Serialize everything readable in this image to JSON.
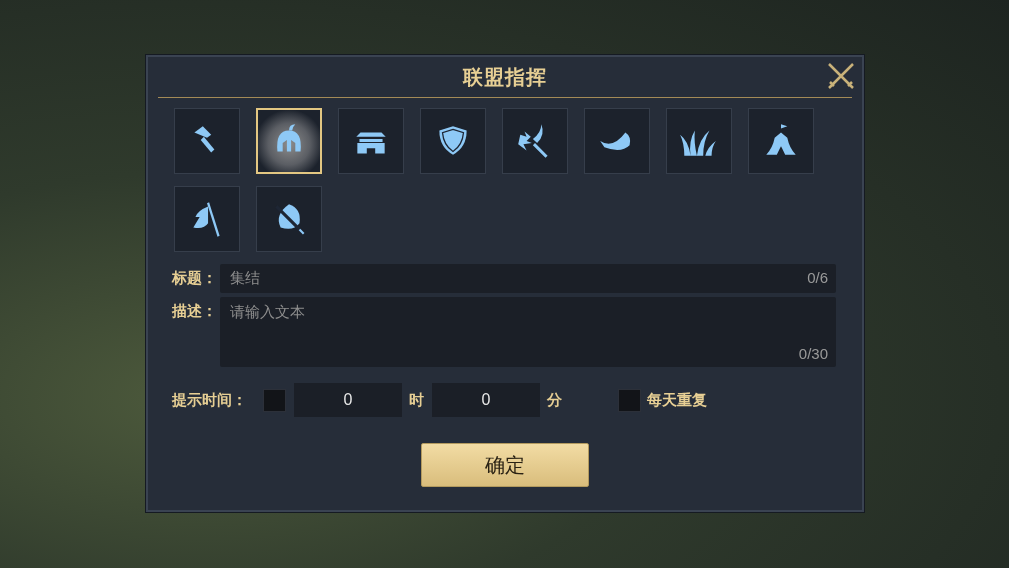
{
  "dialog": {
    "title": "联盟指挥",
    "icons": [
      {
        "selected": false
      },
      {
        "selected": true
      },
      {
        "selected": false
      },
      {
        "selected": false
      },
      {
        "selected": false
      },
      {
        "selected": false
      },
      {
        "selected": false
      },
      {
        "selected": false
      },
      {
        "selected": false
      },
      {
        "selected": false
      }
    ],
    "fields": [
      {
        "kind": "single",
        "label": "标题：",
        "placeholder": "集结",
        "counter": "0/6"
      },
      {
        "kind": "multi",
        "label": "描述：",
        "placeholder": "请输入文本",
        "counter": "0/30"
      }
    ],
    "reminder": {
      "label": "提示时间：",
      "checked": false,
      "hours": "0",
      "hours_unit": "时",
      "minutes": "0",
      "minutes_unit": "分",
      "repeat": {
        "label": "每天重复",
        "checked": false
      }
    },
    "confirm": "确定"
  }
}
